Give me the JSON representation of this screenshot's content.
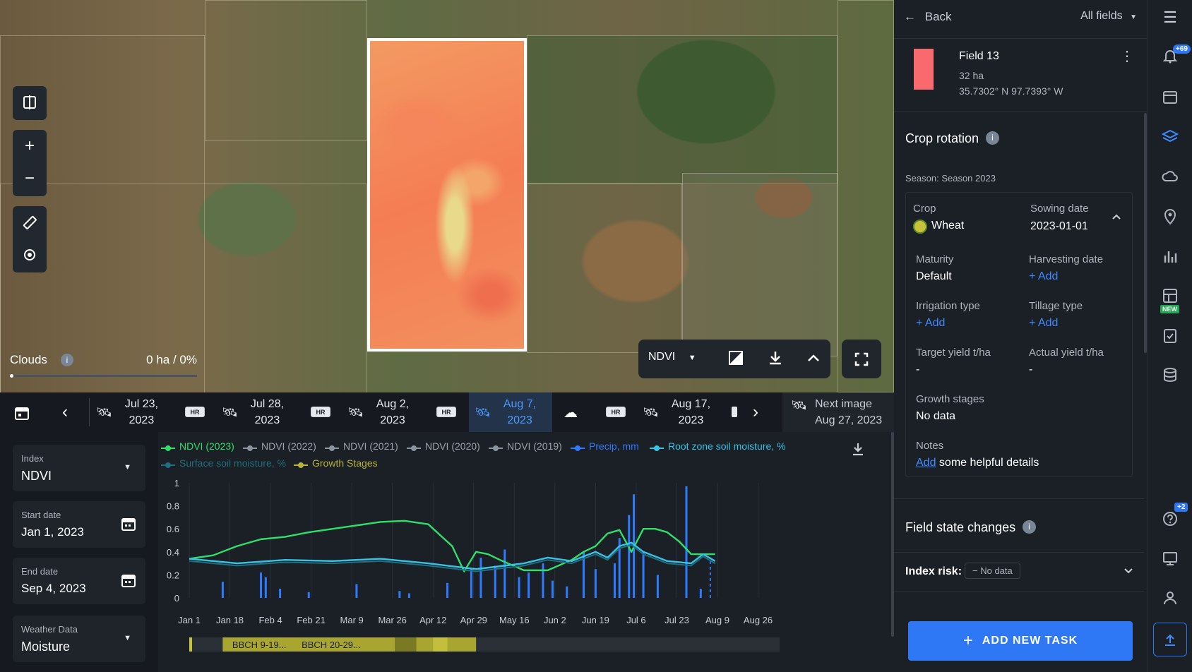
{
  "map": {
    "clouds_label": "Clouds",
    "clouds_value": "0 ha / 0%",
    "index_selector": "NDVI"
  },
  "timeline": {
    "dates": [
      {
        "line1": "Jul 23,",
        "line2": "2023"
      },
      {
        "line1": "Jul 28,",
        "line2": "2023"
      },
      {
        "line1": "Aug 2,",
        "line2": "2023"
      },
      {
        "line1": "Aug 7,",
        "line2": "2023"
      },
      {
        "line1": "Aug 17,",
        "line2": "2023"
      }
    ],
    "hr_label": "HR",
    "next_image_label": "Next image",
    "next_image_date": "Aug 27, 2023"
  },
  "left_panel": {
    "index_label": "Index",
    "index_value": "NDVI",
    "start_label": "Start date",
    "start_value": "Jan 1, 2023",
    "end_label": "End date",
    "end_value": "Sep 4, 2023",
    "weather_label": "Weather Data",
    "weather_value": "Moisture"
  },
  "legend": [
    {
      "label": "NDVI (2023)",
      "color": "#2ee06a"
    },
    {
      "label": "NDVI (2022)",
      "color": "#8a93a0"
    },
    {
      "label": "NDVI (2021)",
      "color": "#8a93a0"
    },
    {
      "label": "NDVI (2020)",
      "color": "#8a93a0"
    },
    {
      "label": "NDVI (2019)",
      "color": "#8a93a0"
    },
    {
      "label": "Precip, mm",
      "color": "#2f7bff"
    },
    {
      "label": "Root zone soil moisture, %",
      "color": "#37c3e6"
    },
    {
      "label": "Surface soil moisture, %",
      "color": "#1f6f7f"
    },
    {
      "label": "Growth Stages",
      "color": "#b7b33a"
    }
  ],
  "chart_data": {
    "type": "line",
    "ylim": [
      0,
      1
    ],
    "y_ticks": [
      "1",
      "0.8",
      "0.6",
      "0.4",
      "0.2",
      "0"
    ],
    "x_ticks": [
      "Jan 1",
      "Jan 18",
      "Feb 4",
      "Feb 21",
      "Mar 9",
      "Mar 26",
      "Apr 12",
      "Apr 29",
      "May 16",
      "Jun 2",
      "Jun 19",
      "Jul 6",
      "Jul 23",
      "Aug 9",
      "Aug 26"
    ],
    "series": [
      {
        "name": "NDVI (2023)",
        "x": [
          0,
          10,
          20,
          30,
          40,
          50,
          60,
          70,
          80,
          90,
          100,
          110,
          115,
          120,
          125,
          130,
          140,
          150,
          160,
          165,
          170,
          175,
          180,
          185,
          190,
          195,
          200,
          205,
          210,
          215,
          220
        ],
        "values": [
          0.34,
          0.37,
          0.45,
          0.51,
          0.53,
          0.57,
          0.6,
          0.63,
          0.66,
          0.67,
          0.64,
          0.45,
          0.23,
          0.4,
          0.38,
          0.33,
          0.24,
          0.24,
          0.33,
          0.4,
          0.45,
          0.56,
          0.59,
          0.4,
          0.6,
          0.6,
          0.57,
          0.49,
          0.38,
          0.38,
          0.38
        ]
      },
      {
        "name": "Root zone soil moisture, %",
        "x": [
          0,
          20,
          40,
          60,
          80,
          100,
          120,
          140,
          150,
          160,
          170,
          175,
          180,
          185,
          190,
          200,
          210,
          215,
          220
        ],
        "values": [
          0.34,
          0.3,
          0.33,
          0.32,
          0.34,
          0.3,
          0.25,
          0.3,
          0.35,
          0.32,
          0.4,
          0.35,
          0.45,
          0.48,
          0.4,
          0.32,
          0.3,
          0.38,
          0.32
        ]
      }
    ],
    "precip_bars": [
      {
        "x": 14,
        "v": 0.14
      },
      {
        "x": 30,
        "v": 0.22
      },
      {
        "x": 32,
        "v": 0.18
      },
      {
        "x": 38,
        "v": 0.08
      },
      {
        "x": 50,
        "v": 0.05
      },
      {
        "x": 70,
        "v": 0.12
      },
      {
        "x": 88,
        "v": 0.06
      },
      {
        "x": 92,
        "v": 0.04
      },
      {
        "x": 108,
        "v": 0.13
      },
      {
        "x": 118,
        "v": 0.25
      },
      {
        "x": 122,
        "v": 0.35
      },
      {
        "x": 128,
        "v": 0.28
      },
      {
        "x": 132,
        "v": 0.42
      },
      {
        "x": 138,
        "v": 0.18
      },
      {
        "x": 142,
        "v": 0.22
      },
      {
        "x": 148,
        "v": 0.3
      },
      {
        "x": 152,
        "v": 0.15
      },
      {
        "x": 158,
        "v": 0.1
      },
      {
        "x": 165,
        "v": 0.4
      },
      {
        "x": 170,
        "v": 0.25
      },
      {
        "x": 178,
        "v": 0.3
      },
      {
        "x": 180,
        "v": 0.52
      },
      {
        "x": 184,
        "v": 0.72
      },
      {
        "x": 186,
        "v": 0.9
      },
      {
        "x": 190,
        "v": 0.4
      },
      {
        "x": 196,
        "v": 0.2
      },
      {
        "x": 208,
        "v": 0.97
      },
      {
        "x": 214,
        "v": 0.08
      }
    ]
  },
  "growth_stages": [
    {
      "label": "BBCH 9-19...",
      "color": "#a8a630"
    },
    {
      "label": "BBCH 20-29...",
      "color": "#a8a630"
    }
  ],
  "right_panel": {
    "back_label": "Back",
    "all_fields_label": "All fields",
    "field_name": "Field 13",
    "field_area": "32 ha",
    "field_coords": "35.7302° N 97.7393° W",
    "field_color": "#f86a6e",
    "crop_rotation_title": "Crop rotation",
    "season_label": "Season: Season 2023",
    "crop_label": "Crop",
    "crop_value": "Wheat",
    "sowing_label": "Sowing date",
    "sowing_value": "2023-01-01",
    "maturity_label": "Maturity",
    "maturity_value": "Default",
    "harvest_label": "Harvesting date",
    "harvest_value": "+ Add",
    "irrigation_label": "Irrigation type",
    "irrigation_value": "+ Add",
    "tillage_label": "Tillage type",
    "tillage_value": "+ Add",
    "target_yield_label": "Target yield t/ha",
    "target_yield_value": "-",
    "actual_yield_label": "Actual yield t/ha",
    "actual_yield_value": "-",
    "growth_label": "Growth stages",
    "growth_value": "No data",
    "notes_label": "Notes",
    "notes_link": "Add",
    "notes_text": "some helpful details",
    "field_state_title": "Field state changes",
    "index_risk_label": "Index risk:",
    "index_risk_value": "No data",
    "add_task_label": "ADD NEW TASK"
  },
  "rail": {
    "notif_badge": "+69",
    "new_badge": "NEW",
    "help_badge": "+2"
  }
}
